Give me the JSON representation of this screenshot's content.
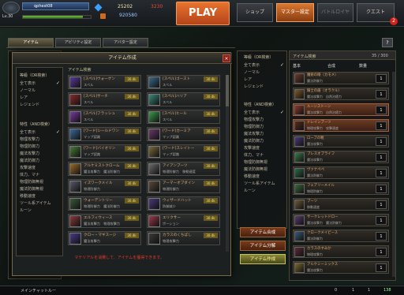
{
  "player": {
    "level": "Lv.30",
    "name": "qphest08",
    "gold": "25202",
    "ruby": "3230",
    "coin": "920580",
    "exp_percent": 88
  },
  "top_nav": {
    "play": "PLAY",
    "buttons": [
      "ショップ",
      "マスター設定",
      "バトルロイヤ",
      "クエスト"
    ],
    "active_index": 1,
    "notification": "2"
  },
  "tabs": [
    "アイテム",
    "アビリティ設定",
    "アバター設定"
  ],
  "tabs_selected": 0,
  "left_filter": {
    "grade_title": "等級（OR検索）",
    "grade_items": [
      "全て表示",
      "ノーマル",
      "レア",
      "レジェンド"
    ],
    "attr_title": "特性（AND検索）",
    "attr_items": [
      "全て表示",
      "物理攻撃力",
      "物理防御力",
      "魔法攻撃力",
      "魔法防御力",
      "攻撃速度",
      "体力、マナ",
      "物理防御無視",
      "魔法防御無視",
      "移動速度",
      "ツール系アイテム",
      "ルーン"
    ]
  },
  "dialog": {
    "title": "アイテム作成",
    "close": "×",
    "list_title": "アイテム検索",
    "items_left": [
      {
        "name": "[スペル]ウォーゲン",
        "sub": "スペル",
        "tag": "30.4k",
        "color": "#5a3a9a"
      },
      {
        "name": "[スペル]サーチ",
        "sub": "スペル",
        "tag": "30.4k",
        "color": "#8a2a2a"
      },
      {
        "name": "[スペル]フラッシュ",
        "sub": "スペル",
        "tag": "30.4k",
        "color": "#7a3aa0"
      },
      {
        "name": "[ワード]シールドワン",
        "sub": "マップ認識",
        "tag": "30.4k",
        "color": "#3a6a9a"
      },
      {
        "name": "[ワード]バイオリン",
        "sub": "マップ認識",
        "tag": "30.4k",
        "color": "#4a7a3a"
      },
      {
        "name": "アルケミストクローム",
        "sub": "魔法攻撃力　魔法防御力",
        "tag": "30.4k",
        "color": "#9a6a2a"
      },
      {
        "name": "イズワークメイル",
        "sub": "物理防御力",
        "tag": "30.4k",
        "color": "#5a5a6a"
      },
      {
        "name": "ウォーデントリー",
        "sub": "物理防御力　魔法防御力",
        "tag": "30.4k",
        "color": "#3a5a3a"
      },
      {
        "name": "エルフィウィース",
        "sub": "魔法攻撃力　物理攻撃力",
        "tag": "30.4k",
        "color": "#8a3a3a"
      },
      {
        "name": "クロー・マギスージ",
        "sub": "魔法攻撃力",
        "tag": "30.4k",
        "color": "#4a3a8a"
      }
    ],
    "items_right": [
      {
        "name": "[スペル]ゴースト",
        "sub": "スペル",
        "tag": "30.4k",
        "color": "#3a6a8a"
      },
      {
        "name": "[スペル]ハリア",
        "sub": "スペル",
        "tag": "30.4k",
        "color": "#3a8a7a"
      },
      {
        "name": "[スペル]ヒール",
        "sub": "スペル",
        "tag": "30.4k",
        "color": "#3a9a4a"
      },
      {
        "name": "[ワード]カーミア",
        "sub": "マップ認識",
        "tag": "30.4k",
        "color": "#6a3a6a"
      },
      {
        "name": "[ワード]スレイトー",
        "sub": "マップ認識",
        "tag": "30.4k",
        "color": "#7a6a3a"
      },
      {
        "name": "アイアンブーツ",
        "sub": "物理防御力　移動速度",
        "tag": "30.4k",
        "color": "#6a6a6a"
      },
      {
        "name": "アーマーオブダイン",
        "sub": "物理防御力",
        "tag": "30.4k",
        "color": "#5a4a3a"
      },
      {
        "name": "ウィザードハット",
        "sub": "防御減少",
        "tag": "30.4k",
        "color": "#4a3a7a"
      },
      {
        "name": "エリクサー",
        "sub": "ポーション",
        "tag": "30.4k",
        "color": "#9a3a4a"
      },
      {
        "name": "カラスのくちばし",
        "sub": "物理攻撃力",
        "tag": "30.4k",
        "color": "#3a3a3a"
      }
    ],
    "message": "マテリアルを消費して、アイテムを獲得できます。"
  },
  "right_filter": {
    "grade_title": "等級（OR検索）",
    "grade_items": [
      "全て表示",
      "ノーマル",
      "レア",
      "レジェンド"
    ],
    "attr_title": "特性（AND検索）",
    "attr_items": [
      "全て表示",
      "物理攻撃力",
      "物理防御力",
      "魔法攻撃力",
      "魔法防御力",
      "攻撃速度",
      "体力、マナ",
      "物理防御無視",
      "魔法防御無視",
      "移動速度",
      "ツール系アイテム",
      "ルーン"
    ]
  },
  "actions": {
    "combine": "アイテム合成",
    "split": "アイテム分解",
    "create": "アイテム作成"
  },
  "inventory": {
    "title": "アイテム検索",
    "count": "35 / 300",
    "headers": [
      "基本",
      "合成",
      "数量"
    ],
    "items": [
      {
        "name": "魔術の眼（カモメ）",
        "sub": "魔法防御力",
        "qty": "1",
        "hl": false,
        "color": "#6a3a2a"
      },
      {
        "name": "騎士の盾（オラクル）",
        "sub": "魔法攻撃力　自然治癒力",
        "qty": "1",
        "hl": false,
        "color": "#7a5a2a"
      },
      {
        "name": "ルーンストーン",
        "sub": "魔法攻撃力　自然治癒力",
        "qty": "1",
        "hl": true,
        "color": "#8a3a2a"
      },
      {
        "name": "ドレインブーツ",
        "sub": "物理攻撃力　攻撃速度",
        "qty": "1",
        "hl": true,
        "color": "#5a2a1a"
      },
      {
        "name": "ローブの靴",
        "sub": "魔法攻撃力",
        "qty": "1",
        "hl": false,
        "color": "#4a3a7a"
      },
      {
        "name": "ブレスオブライフ",
        "sub": "魔法攻撃力",
        "qty": "1",
        "hl": false,
        "color": "#3a7a4a"
      },
      {
        "name": "ヴァナペペ",
        "sub": "魔法防御力",
        "qty": "1",
        "hl": false,
        "color": "#2a6a4a"
      },
      {
        "name": "フェアリーメイル",
        "sub": "物理防御力",
        "qty": "1",
        "hl": false,
        "color": "#3a6a3a"
      },
      {
        "name": "ブーツ",
        "sub": "移動速度",
        "qty": "1",
        "hl": false,
        "color": "#6a5a3a"
      },
      {
        "name": "サークレットドロー",
        "sub": "魔法攻撃力　魔法防御力",
        "qty": "1",
        "hl": false,
        "color": "#5a3a6a"
      },
      {
        "name": "クロークメイピース",
        "sub": "魔法防御力",
        "qty": "1",
        "hl": false,
        "color": "#3a5a7a"
      },
      {
        "name": "カラスのすみか",
        "sub": "物理攻撃力",
        "qty": "1",
        "hl": false,
        "color": "#5a2a3a"
      },
      {
        "name": "アルケミーミックス",
        "sub": "魔法攻撃力",
        "qty": "1",
        "hl": false,
        "color": "#7a6a2a"
      }
    ]
  },
  "status_bar": {
    "chat": "メインチャットルー",
    "value_a": "0",
    "value_b": "1",
    "value_c": "1",
    "fps": "138"
  }
}
